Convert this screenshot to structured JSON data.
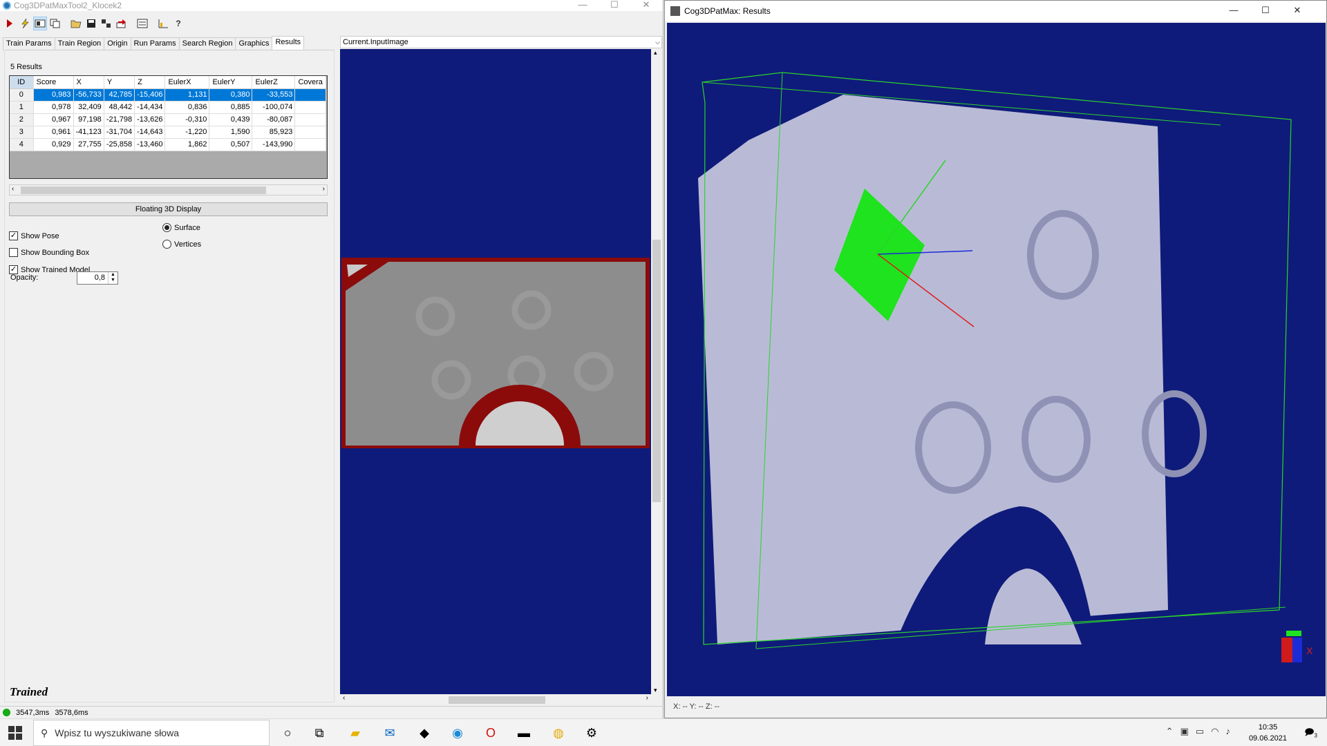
{
  "win1": {
    "title": "Cog3DPatMaxTool2_Klocek2"
  },
  "win2": {
    "title": "Cog3DPatMax: Results",
    "coords": "X: --  Y: --  Z: --"
  },
  "tabs": [
    "Train Params",
    "Train Region",
    "Origin",
    "Run Params",
    "Search Region",
    "Graphics",
    "Results"
  ],
  "results": {
    "count_label": "5 Results",
    "columns": [
      "ID",
      "Score",
      "X",
      "Y",
      "Z",
      "EulerX",
      "EulerY",
      "EulerZ",
      "Covera"
    ],
    "rows": [
      [
        "0",
        "0,983",
        "-56,733",
        "42,785",
        "-15,406",
        "1,131",
        "0,380",
        "-33,553",
        ""
      ],
      [
        "1",
        "0,978",
        "32,409",
        "48,442",
        "-14,434",
        "0,836",
        "0,885",
        "-100,074",
        ""
      ],
      [
        "2",
        "0,967",
        "97,198",
        "-21,798",
        "-13,626",
        "-0,310",
        "0,439",
        "-80,087",
        ""
      ],
      [
        "3",
        "0,961",
        "-41,123",
        "-31,704",
        "-14,643",
        "-1,220",
        "1,590",
        "85,923",
        ""
      ],
      [
        "4",
        "0,929",
        "27,755",
        "-25,858",
        "-13,460",
        "1,862",
        "0,507",
        "-143,990",
        ""
      ]
    ]
  },
  "display": {
    "button": "Floating 3D Display",
    "show_pose": "Show Pose",
    "show_bbox": "Show Bounding Box",
    "show_trained": "Show Trained Model",
    "surface": "Surface",
    "vertices": "Vertices",
    "opacity_label": "Opacity:",
    "opacity_value": "0,8"
  },
  "status": {
    "trained": "Trained",
    "t1": "3547,3ms",
    "t2": "3578,6ms"
  },
  "image": {
    "header": "Current.InputImage"
  },
  "taskbar": {
    "search_placeholder": "Wpisz tu wyszukiwane słowa",
    "time": "10:35",
    "date": "09.06.2021",
    "notif": "3"
  }
}
